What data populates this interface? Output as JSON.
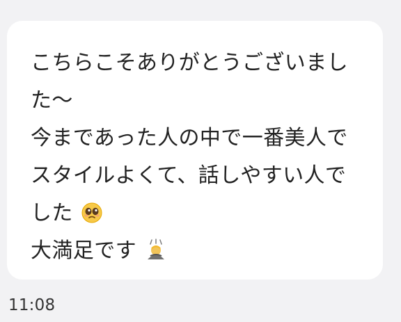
{
  "message": {
    "lines": [
      "こちらこそありがとうございまし",
      "た〜",
      "今まであった人の中で一番美人で",
      "スタイルよくて、話しやすい人で",
      "した",
      "大満足です"
    ],
    "emojis": {
      "line5": "pleading-face-icon",
      "line6": "bowing-person-icon"
    }
  },
  "timestamp": "11:08",
  "colors": {
    "background": "#f2f2f4",
    "bubble": "#ffffff",
    "text": "#222222",
    "timestamp": "#333333"
  }
}
